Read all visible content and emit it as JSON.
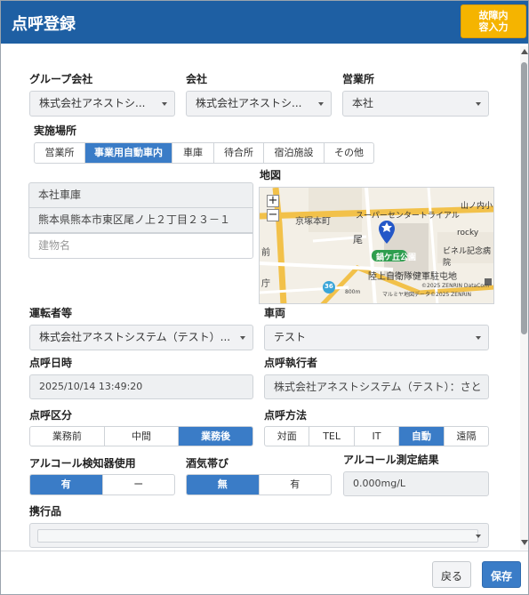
{
  "window": {
    "title": "点呼登録",
    "fault_button": "故障内容入力"
  },
  "form": {
    "group_company": {
      "label": "グループ会社",
      "value": "株式会社アネストシ..."
    },
    "company": {
      "label": "会社",
      "value": "株式会社アネストシ..."
    },
    "office": {
      "label": "営業所",
      "value": "本社"
    },
    "location": {
      "label": "実施場所",
      "options": [
        "営業所",
        "事業用自動車内",
        "車庫",
        "待合所",
        "宿泊施設",
        "その他"
      ],
      "selected": "事業用自動車内"
    },
    "place_name": "本社車庫",
    "address": "熊本県熊本市東区尾ノ上２丁目２３－１",
    "building_placeholder": "建物名",
    "map": {
      "label": "地図",
      "labels": {
        "kyotsuka": "京塚本町",
        "supercenter": "スーパーセンタートライアル",
        "yamanouchi": "山ノ内小",
        "rocky": "rocky",
        "park": "鍋ケ丘公園",
        "biner": "ビネル記念病院",
        "army": "陸上自衛隊健軍駐屯地",
        "mae": "前",
        "o": "尾",
        "cho": "庁",
        "route": "36",
        "scale": "800m",
        "copyright1": "©2025 ZENRIN DataCom",
        "copyright2": "マルミヤ地図データ©2025 ZENRIN"
      },
      "icons": [
        "zoom-in-icon",
        "zoom-out-icon",
        "map-pin-icon"
      ]
    },
    "driver": {
      "label": "運転者等",
      "value": "株式会社アネストシステム（テスト）..."
    },
    "vehicle": {
      "label": "車両",
      "value": "テスト"
    },
    "call_datetime": {
      "label": "点呼日時",
      "value": "2025/10/14 13:49:20"
    },
    "executor": {
      "label": "点呼執行者",
      "value": "株式会社アネストシステム（テスト）：さと"
    },
    "call_type": {
      "label": "点呼区分",
      "options": [
        "業務前",
        "中間",
        "業務後"
      ],
      "selected": "業務後"
    },
    "call_method": {
      "label": "点呼方法",
      "options": [
        "対面",
        "TEL",
        "IT",
        "自動",
        "遠隔"
      ],
      "selected": "自動"
    },
    "detector_use": {
      "label": "アルコール検知器使用",
      "options": [
        "有",
        "ー"
      ],
      "selected": "有"
    },
    "alcohol_smell": {
      "label": "酒気帯び",
      "options": [
        "無",
        "有"
      ],
      "selected": "無"
    },
    "alcohol_result": {
      "label": "アルコール測定結果",
      "value": "0.000mg/L"
    },
    "belongings": {
      "label": "携行品",
      "value": ""
    }
  },
  "footer": {
    "back_label": "戻る",
    "save_label": "保存"
  },
  "colors": {
    "header": "#1e5fa3",
    "accent": "#3a7cc7",
    "fault_button": "#f5b400"
  }
}
